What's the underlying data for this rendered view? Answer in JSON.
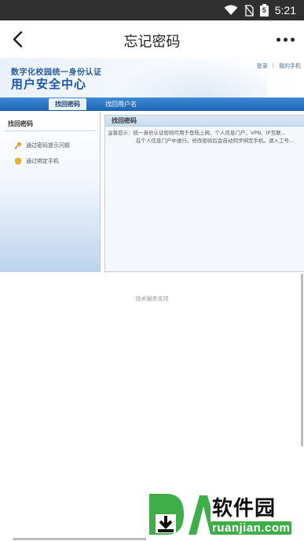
{
  "status_bar": {
    "time": "5:21",
    "battery_level": "5",
    "icons": [
      "wifi-icon",
      "no-sim-icon",
      "battery-icon"
    ]
  },
  "app_bar": {
    "title": "忘记密码",
    "back_icon": "back-arrow-icon",
    "more_icon": "more-icon"
  },
  "web": {
    "banner": {
      "line1": "数字化校园统一身份认证",
      "line2": "用户安全中心",
      "links": [
        "登录",
        "我的手机"
      ],
      "separator": "|"
    },
    "nav_tabs": [
      {
        "label": "找回密码",
        "active": true
      },
      {
        "label": "找回用户名",
        "active": false
      }
    ],
    "sidebar": {
      "title": "找回密码",
      "items": [
        {
          "label": "通过密码提示问题",
          "icon": "key-icon"
        },
        {
          "label": "通过绑定手机",
          "icon": "shield-icon"
        }
      ]
    },
    "panel": {
      "title": "找回密码",
      "label": "温馨提示：",
      "lines": [
        "统一身份认证密码可用于登陆上网、个人信息门户、VPN、IP互联...",
        "在个人信息门户中进行。修改密码后会自动同步绑定手机。请入工号..."
      ]
    },
    "footer": "技术服务支持"
  },
  "watermark": {
    "text": "软件园",
    "url": "ruanjian.com",
    "colors": {
      "green": "#3fae49",
      "dark": "#0d0d0d"
    }
  },
  "colors": {
    "status_bar": "#2f2f2f",
    "nav_blue": "#1f67b6",
    "banner_title": "#1b56a8"
  }
}
